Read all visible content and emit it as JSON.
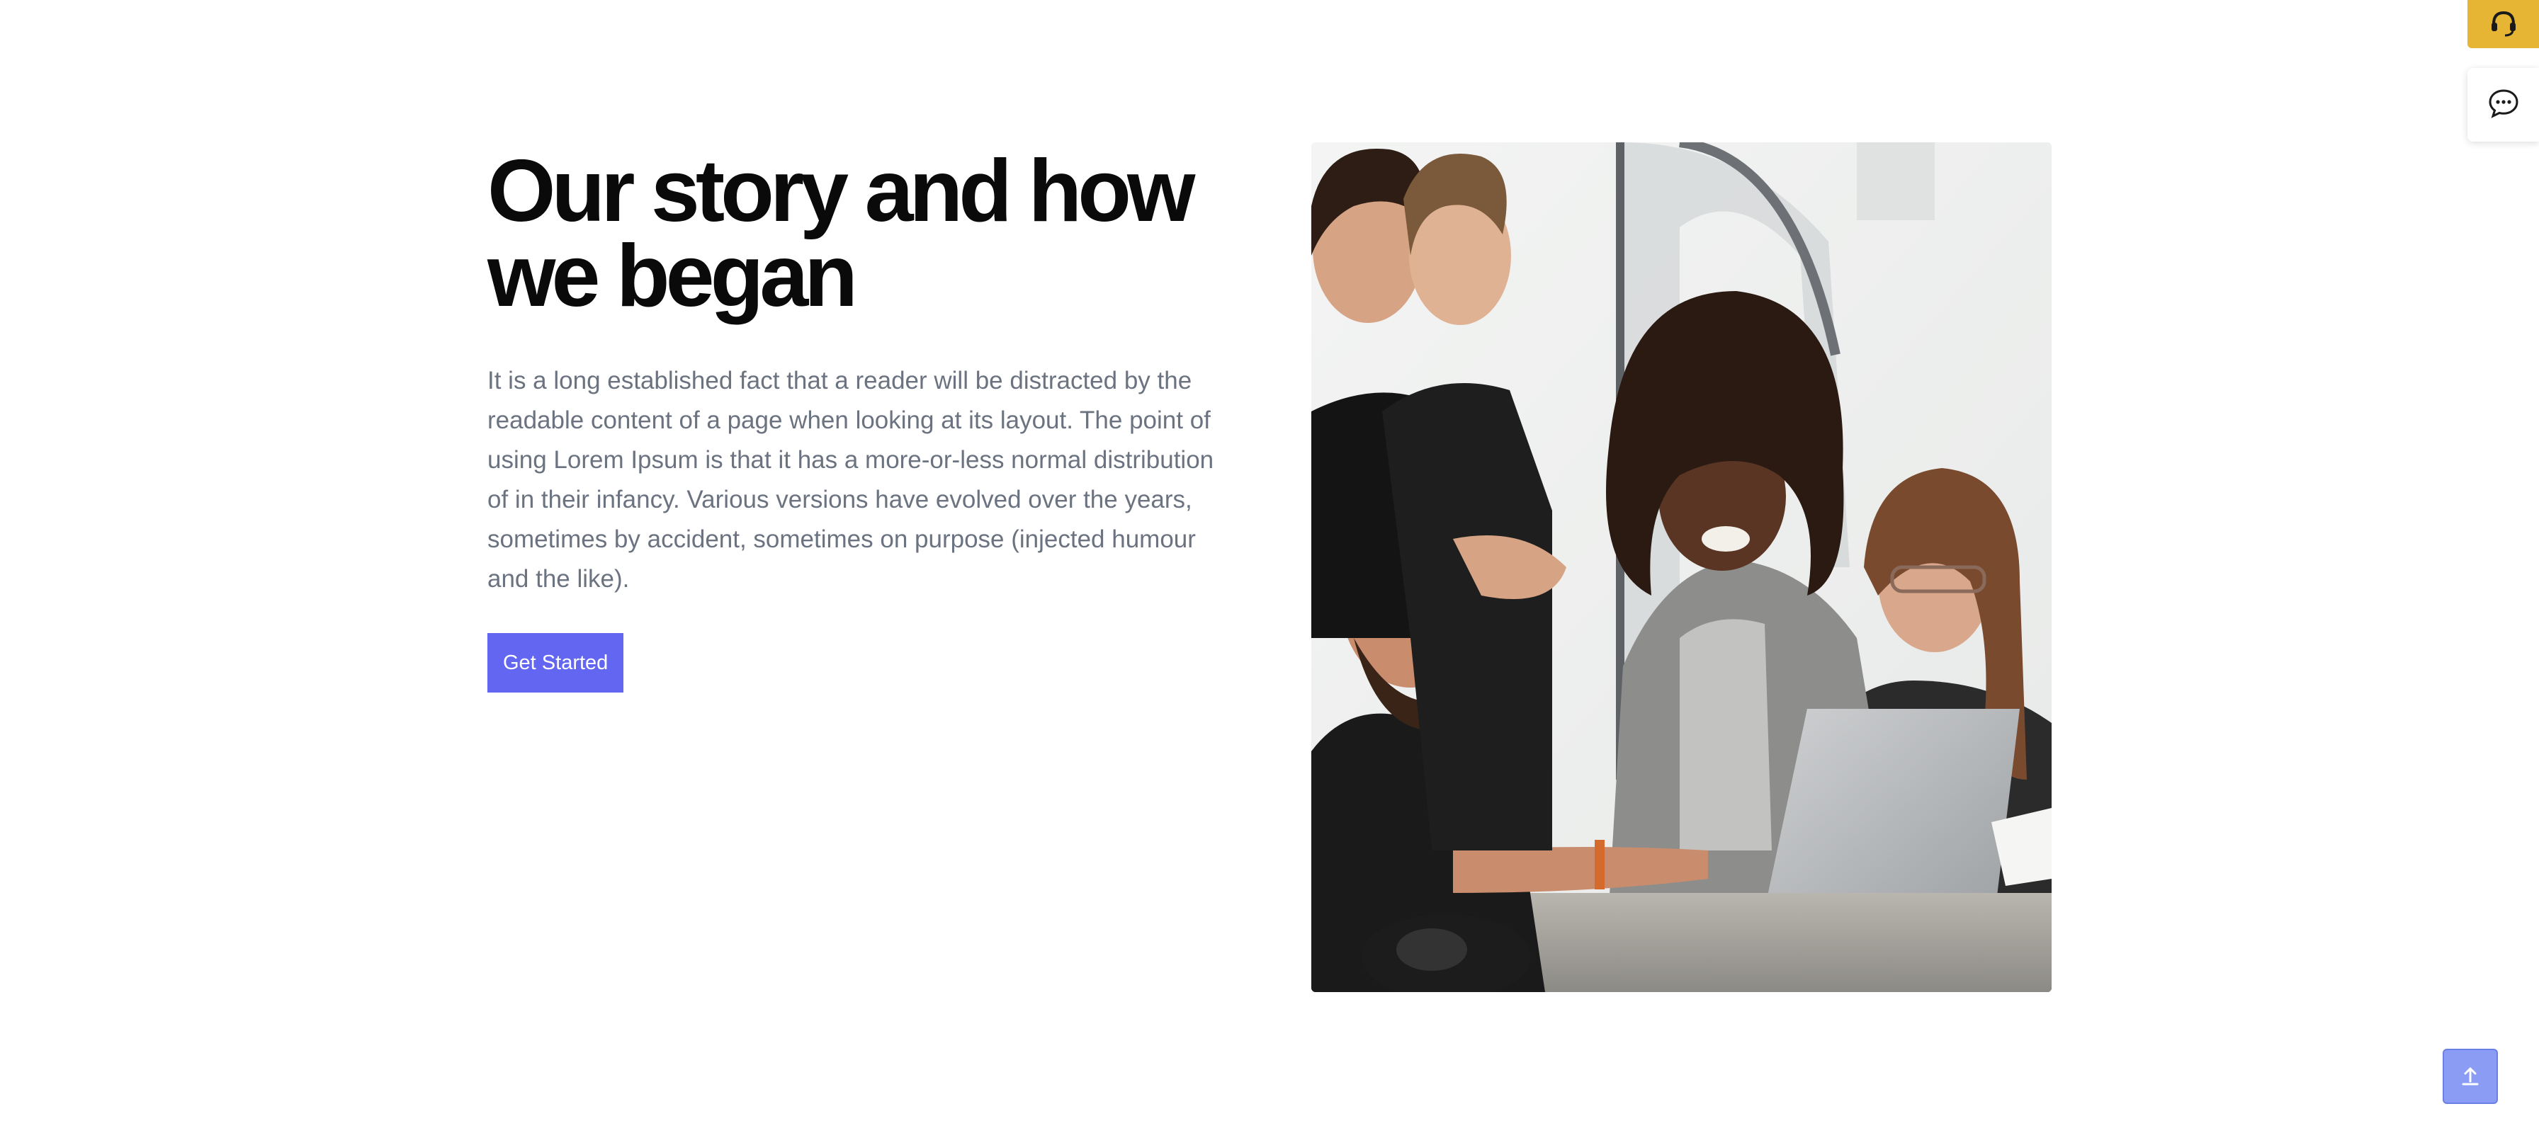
{
  "story": {
    "title_line1": "Our story and how",
    "title_line2": "we began",
    "body": "It is a long established fact that a reader will be distracted by the readable content of a page when looking at its layout. The point of using Lorem Ipsum is that it has a more-or-less normal distribution of in their infancy. Various versions have evolved over the years, sometimes by accident, sometimes on purpose (injected humour and the like).",
    "cta_label": "Get Started"
  },
  "image": {
    "alt": "team-photo"
  },
  "widgets": {
    "support_icon": "headset-icon",
    "chat_icon": "chat-bubble-icon",
    "scroll_top_icon": "arrow-up-icon"
  },
  "colors": {
    "accent": "#6366f1",
    "support": "#e6b534",
    "scroll_top": "#8b9cf5",
    "body_text": "#6b7280",
    "heading": "#0a0a0a"
  }
}
